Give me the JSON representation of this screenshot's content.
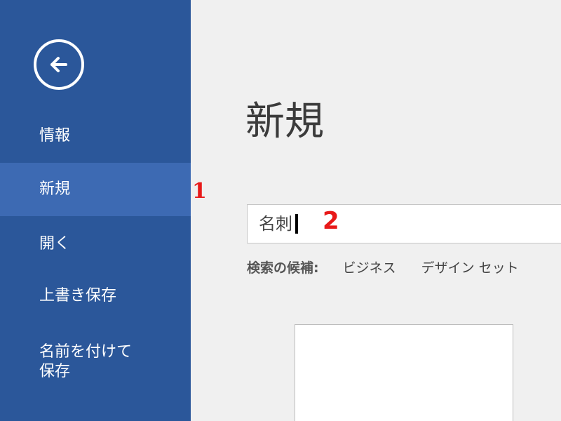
{
  "sidebar": {
    "items": [
      {
        "label": "情報"
      },
      {
        "label": "新規"
      },
      {
        "label": "開く"
      },
      {
        "label": "上書き保存"
      },
      {
        "label": "名前を付けて 保存"
      }
    ]
  },
  "annotations": {
    "step1": "1",
    "step2": "2"
  },
  "main": {
    "title": "新規",
    "search": {
      "value": "名刺"
    },
    "suggestions": {
      "label": "検索の候補:",
      "items": [
        "ビジネス",
        "デザイン セット"
      ]
    }
  },
  "colors": {
    "sidebar": "#2b579a",
    "sidebar_selected": "#3d6ab3",
    "annotation": "#e81919"
  },
  "icons": {
    "back": "back-arrow-icon"
  }
}
